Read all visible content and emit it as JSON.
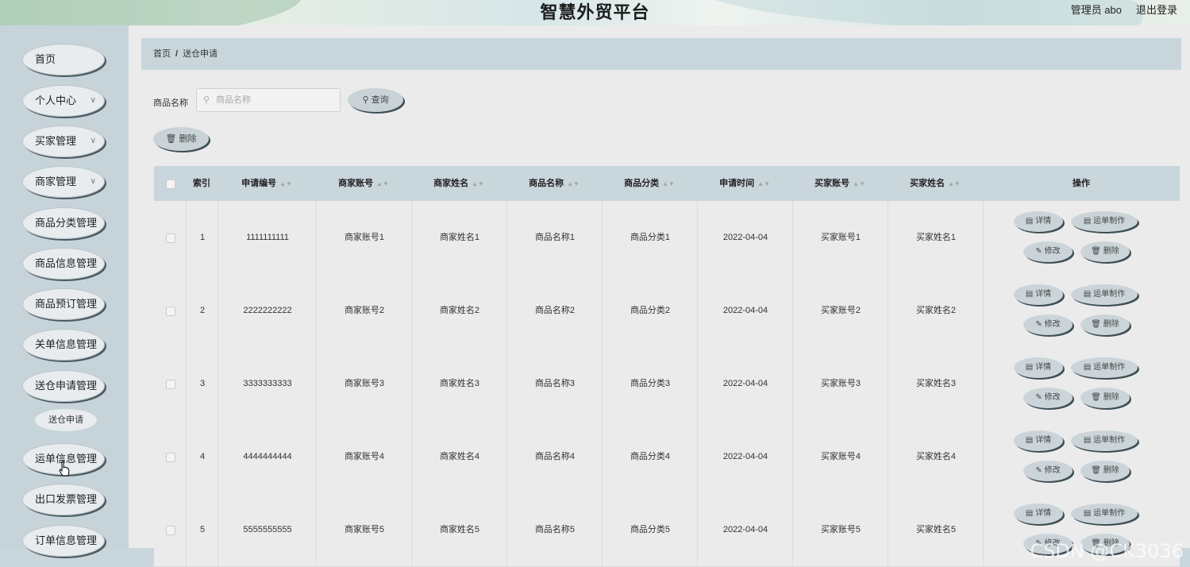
{
  "header": {
    "title": "智慧外贸平台",
    "user": "管理员 abo",
    "logout": "退出登录"
  },
  "sidebar": {
    "items": [
      {
        "label": "首页",
        "has_chevron": false
      },
      {
        "label": "个人中心",
        "has_chevron": true
      },
      {
        "label": "买家管理",
        "has_chevron": true
      },
      {
        "label": "商家管理",
        "has_chevron": true
      },
      {
        "label": "商品分类管理",
        "has_chevron": false
      },
      {
        "label": "商品信息管理",
        "has_chevron": false
      },
      {
        "label": "商品预订管理",
        "has_chevron": false
      },
      {
        "label": "关单信息管理",
        "has_chevron": false
      },
      {
        "label": "送仓申请管理",
        "has_chevron": false
      },
      {
        "label": "运单信息管理",
        "has_chevron": false
      },
      {
        "label": "出口发票管理",
        "has_chevron": false
      },
      {
        "label": "订单信息管理",
        "has_chevron": false
      }
    ],
    "submenu": {
      "label": "送仓申请"
    }
  },
  "breadcrumb": {
    "home": "首页",
    "sep": "/",
    "current": "送仓申请"
  },
  "search": {
    "label": "商品名称",
    "placeholder": "商品名称",
    "button": "查询",
    "delete_button": "删除"
  },
  "table": {
    "headers": [
      "索引",
      "申请编号",
      "商家账号",
      "商家姓名",
      "商品名称",
      "商品分类",
      "申请时间",
      "买家账号",
      "买家姓名",
      "操作"
    ],
    "rows": [
      [
        "1",
        "1111111111",
        "商家账号1",
        "商家姓名1",
        "商品名称1",
        "商品分类1",
        "2022-04-04",
        "买家账号1",
        "买家姓名1"
      ],
      [
        "2",
        "2222222222",
        "商家账号2",
        "商家姓名2",
        "商品名称2",
        "商品分类2",
        "2022-04-04",
        "买家账号2",
        "买家姓名2"
      ],
      [
        "3",
        "3333333333",
        "商家账号3",
        "商家姓名3",
        "商品名称3",
        "商品分类3",
        "2022-04-04",
        "买家账号3",
        "买家姓名3"
      ],
      [
        "4",
        "4444444444",
        "商家账号4",
        "商家姓名4",
        "商品名称4",
        "商品分类4",
        "2022-04-04",
        "买家账号4",
        "买家姓名4"
      ],
      [
        "5",
        "5555555555",
        "商家账号5",
        "商家姓名5",
        "商品名称5",
        "商品分类5",
        "2022-04-04",
        "买家账号5",
        "买家姓名5"
      ]
    ],
    "actions": {
      "detail": "详情",
      "waybill": "运单制作",
      "edit": "修改",
      "delete": "删除"
    }
  },
  "watermark": "CSDN @CK3036"
}
